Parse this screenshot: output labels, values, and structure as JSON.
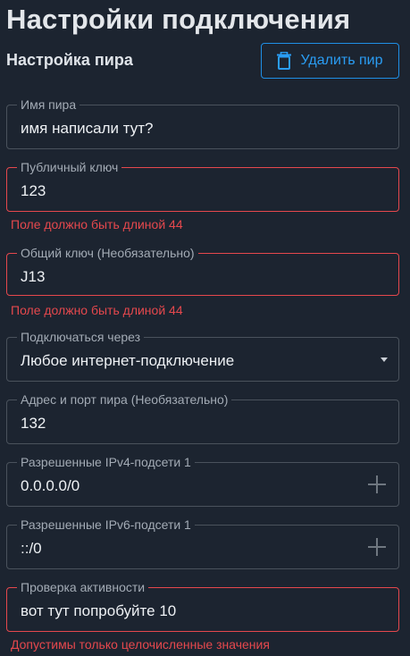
{
  "page": {
    "title": "Настройки подключения",
    "section_title": "Настройка пира"
  },
  "toolbar": {
    "delete_label": "Удалить пир",
    "delete_icon": "trash-icon"
  },
  "form": {
    "peer_name": {
      "label": "Имя пира",
      "value": "имя написали тут?"
    },
    "public_key": {
      "label": "Публичный ключ",
      "value": "123",
      "error": "Поле должно быть длиной 44"
    },
    "shared_key": {
      "label": "Общий ключ (Необязательно)",
      "value": "J13",
      "error": "Поле должно быть длиной 44"
    },
    "connect_via": {
      "label": "Подключаться через",
      "value": "Любое интернет-подключение"
    },
    "endpoint": {
      "label": "Адрес и порт пира (Необязательно)",
      "value": "132"
    },
    "allowed_ipv4": {
      "label": "Разрешенные IPv4-подсети 1",
      "value": "0.0.0.0/0"
    },
    "allowed_ipv6": {
      "label": "Разрешенные IPv6-подсети 1",
      "value": "::/0"
    },
    "keepalive": {
      "label": "Проверка активности",
      "value": "вот тут попробуйте 10",
      "error": "Допустимы только целочисленные значения"
    }
  },
  "colors": {
    "background": "#1c2430",
    "accent": "#1f8fe6",
    "error": "#e5484d",
    "border": "#4a525c"
  }
}
